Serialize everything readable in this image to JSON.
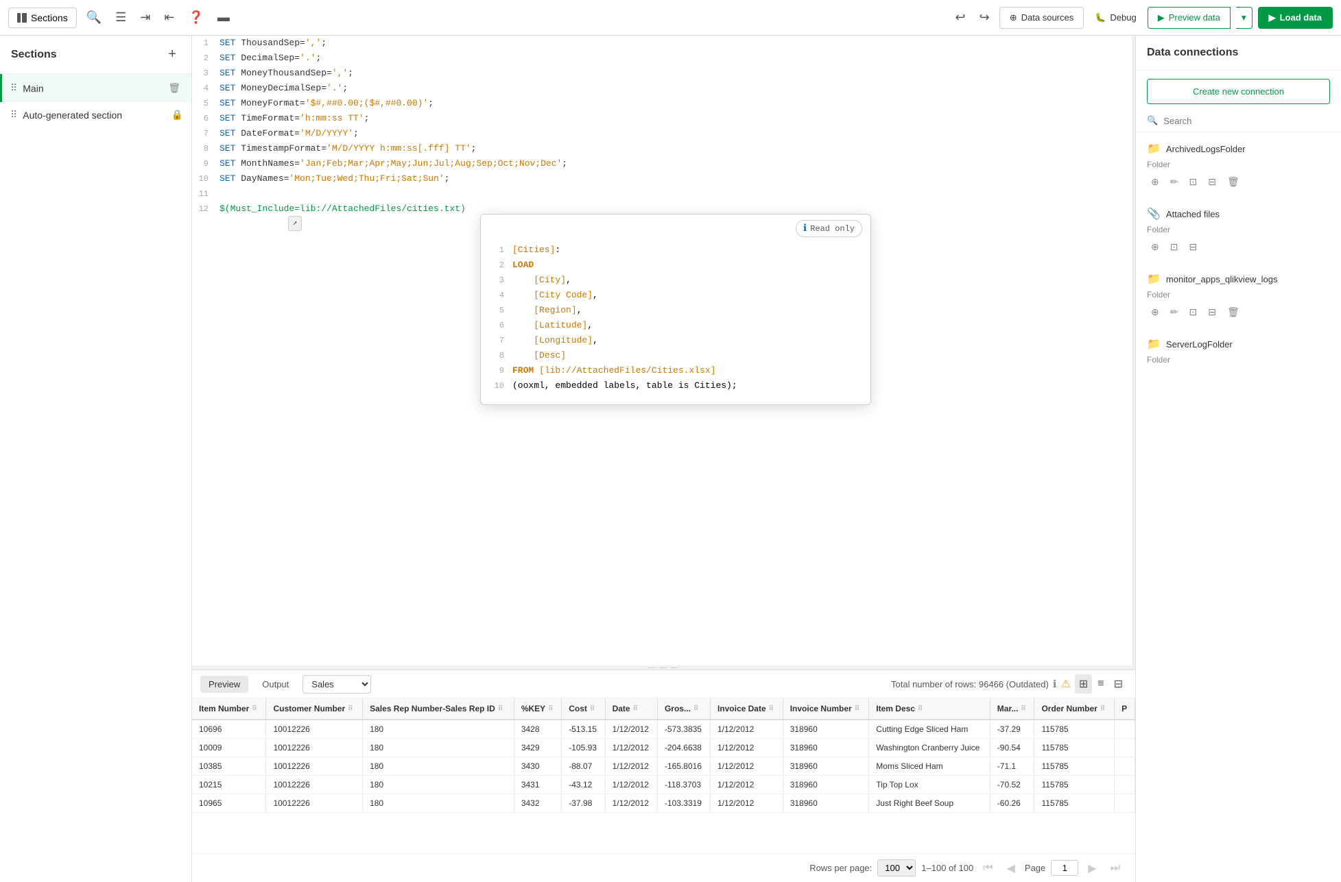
{
  "toolbar": {
    "sections_label": "Sections",
    "undo_icon": "↩",
    "redo_icon": "↪",
    "datasources_label": "Data sources",
    "debug_label": "Debug",
    "preview_label": "Preview data",
    "load_label": "Load data"
  },
  "sidebar": {
    "title": "Sections",
    "add_icon": "+",
    "items": [
      {
        "label": "Main",
        "icon": "⠿",
        "active": true
      },
      {
        "label": "Auto-generated section",
        "icon": "⠿",
        "active": false
      }
    ]
  },
  "editor": {
    "lines": [
      {
        "num": "1",
        "content": "SET ThousandSep=',';",
        "type": "set"
      },
      {
        "num": "2",
        "content": "SET DecimalSep='.';",
        "type": "set"
      },
      {
        "num": "3",
        "content": "SET MoneyThousandSep=',';",
        "type": "set"
      },
      {
        "num": "4",
        "content": "SET MoneyDecimalSep='.';",
        "type": "set"
      },
      {
        "num": "5",
        "content": "SET MoneyFormat='$#,##0.00;($#,##0.00)';",
        "type": "set"
      },
      {
        "num": "6",
        "content": "SET TimeFormat='h:mm:ss TT';",
        "type": "set"
      },
      {
        "num": "7",
        "content": "SET DateFormat='M/D/YYYY';",
        "type": "set"
      },
      {
        "num": "8",
        "content": "SET TimestampFormat='M/D/YYYY h:mm:ss[.fff] TT';",
        "type": "set"
      },
      {
        "num": "9",
        "content": "SET MonthNames='Jan;Feb;Mar;Apr;May;Jun;Jul;Aug;Sep;Oct;Nov;Dec';",
        "type": "set"
      },
      {
        "num": "10",
        "content": "SET DayNames='Mon;Tue;Wed;Thu;Fri;Sat;Sun';",
        "type": "set"
      },
      {
        "num": "11",
        "content": "",
        "type": "empty"
      },
      {
        "num": "12",
        "content": "$(Must_Include=lib://AttachedFiles/cities.txt)",
        "type": "func",
        "has_tag": true
      }
    ]
  },
  "popup": {
    "read_only_label": "Read only",
    "lines": [
      {
        "num": "1",
        "content": "[Cities]:",
        "type": "label"
      },
      {
        "num": "2",
        "content": "LOAD",
        "type": "keyword"
      },
      {
        "num": "3",
        "content": "    [City],",
        "type": "field"
      },
      {
        "num": "4",
        "content": "    [City Code],",
        "type": "field"
      },
      {
        "num": "5",
        "content": "    [Region],",
        "type": "field"
      },
      {
        "num": "6",
        "content": "    [Latitude],",
        "type": "field"
      },
      {
        "num": "7",
        "content": "    [Longitude],",
        "type": "field"
      },
      {
        "num": "8",
        "content": "    [Desc]",
        "type": "field"
      },
      {
        "num": "9",
        "content": "FROM [lib://AttachedFiles/Cities.xlsx]",
        "type": "from"
      },
      {
        "num": "10",
        "content": "(ooxml, embedded labels, table is Cities);",
        "type": "plain"
      }
    ]
  },
  "right_panel": {
    "title": "Data connections",
    "create_label": "Create new connection",
    "search_placeholder": "Search",
    "connections": [
      {
        "name": "ArchivedLogsFolder",
        "type": "Folder",
        "actions": [
          "copy",
          "edit",
          "select",
          "select2",
          "delete"
        ]
      },
      {
        "name": "Attached files",
        "type": "Folder",
        "actions": [
          "copy",
          "select",
          "select2"
        ]
      },
      {
        "name": "monitor_apps_qlikview_logs",
        "type": "Folder",
        "actions": [
          "copy",
          "edit",
          "select",
          "select2",
          "delete"
        ]
      },
      {
        "name": "ServerLogFolder",
        "type": "Folder",
        "actions": []
      }
    ]
  },
  "bottom": {
    "tabs": [
      {
        "label": "Preview",
        "active": true
      },
      {
        "label": "Output",
        "active": false
      }
    ],
    "table_select": "Sales",
    "status": "Total number of rows: 96466 (Outdated)",
    "rows_per_page": "100",
    "page_range": "1–100 of 100",
    "page_label": "Page",
    "page_value": "1",
    "columns": [
      {
        "label": "Item Number"
      },
      {
        "label": "Customer Number"
      },
      {
        "label": "Sales Rep Number-Sales Rep ID"
      },
      {
        "label": "%KEY"
      },
      {
        "label": "Cost"
      },
      {
        "label": "Date"
      },
      {
        "label": "Gros..."
      },
      {
        "label": "Invoice Date"
      },
      {
        "label": "Invoice Number"
      },
      {
        "label": "Item Desc"
      },
      {
        "label": "Mar..."
      },
      {
        "label": "Order Number"
      },
      {
        "label": "P"
      }
    ],
    "rows": [
      [
        "10696",
        "10012226",
        "180",
        "3428",
        "-513.15",
        "1/12/2012",
        "-573.3835",
        "1/12/2012",
        "318960",
        "Cutting Edge Sliced Ham",
        "-37.29",
        "115785",
        ""
      ],
      [
        "10009",
        "10012226",
        "180",
        "3429",
        "-105.93",
        "1/12/2012",
        "-204.6638",
        "1/12/2012",
        "318960",
        "Washington Cranberry Juice",
        "-90.54",
        "115785",
        ""
      ],
      [
        "10385",
        "10012226",
        "180",
        "3430",
        "-88.07",
        "1/12/2012",
        "-165.8016",
        "1/12/2012",
        "318960",
        "Moms Sliced Ham",
        "-71.1",
        "115785",
        ""
      ],
      [
        "10215",
        "10012226",
        "180",
        "3431",
        "-43.12",
        "1/12/2012",
        "-118.3703",
        "1/12/2012",
        "318960",
        "Tip Top Lox",
        "-70.52",
        "115785",
        ""
      ],
      [
        "10965",
        "10012226",
        "180",
        "3432",
        "-37.98",
        "1/12/2012",
        "-103.3319",
        "1/12/2012",
        "318960",
        "Just Right Beef Soup",
        "-60.26",
        "115785",
        ""
      ]
    ]
  },
  "colors": {
    "green": "#009845",
    "blue": "#0066cc",
    "orange": "#cc7700",
    "gray": "#888888"
  }
}
